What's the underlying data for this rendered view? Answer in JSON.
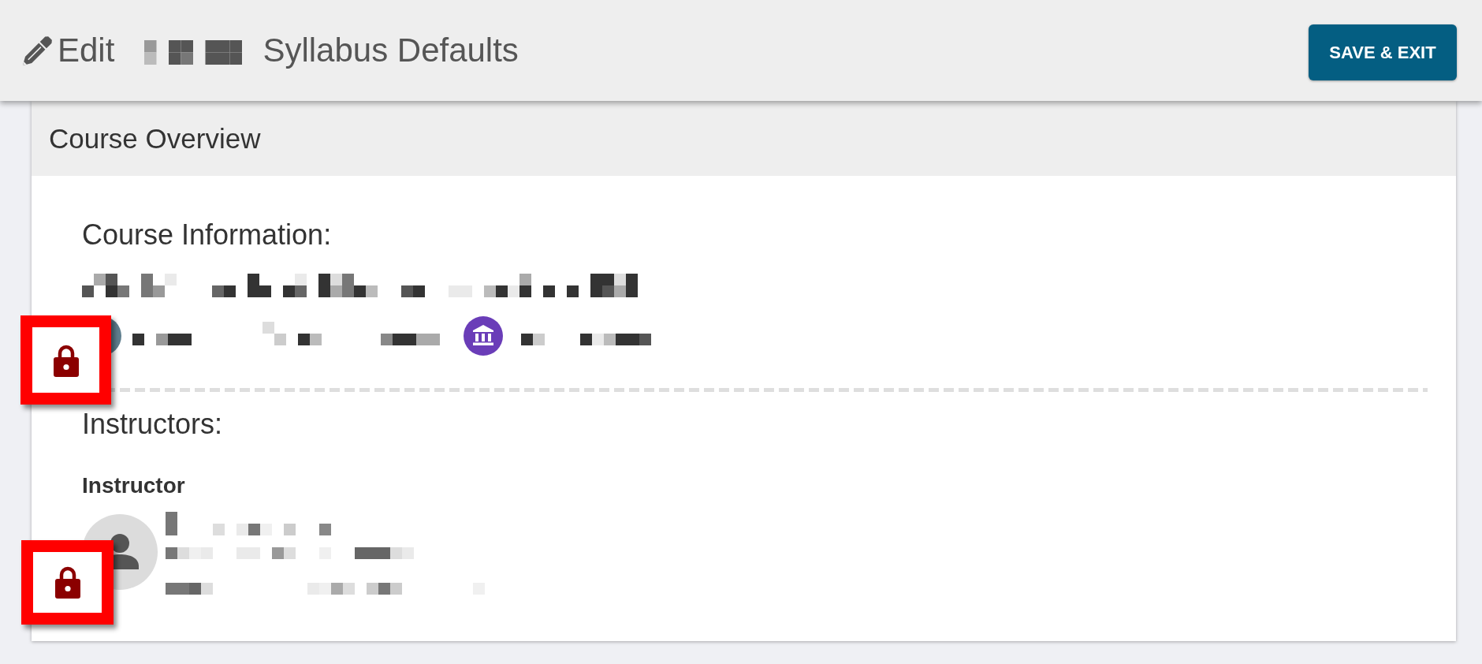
{
  "header": {
    "title_prefix": "Edit",
    "title": "Syllabus Defaults",
    "save_button": "SAVE & EXIT"
  },
  "course_overview": {
    "title": "Course Overview",
    "course_information": {
      "heading": "Course Information:",
      "locked": true
    },
    "instructors": {
      "heading": "Instructors:",
      "locked": true,
      "items": [
        {
          "role": "Instructor"
        }
      ]
    }
  }
}
